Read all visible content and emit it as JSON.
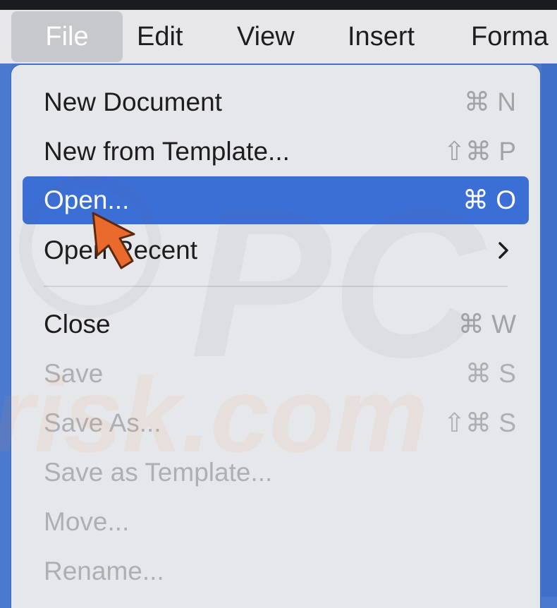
{
  "menubar": {
    "items": [
      {
        "label": "File",
        "selected": true
      },
      {
        "label": "Edit"
      },
      {
        "label": "View"
      },
      {
        "label": "Insert"
      },
      {
        "label": "Forma"
      }
    ]
  },
  "file_menu": {
    "items": [
      {
        "label": "New Document",
        "shortcut": "⌘ N",
        "state": "enabled"
      },
      {
        "label": "New from Template...",
        "shortcut": "⇧⌘ P",
        "state": "enabled"
      },
      {
        "label": "Open...",
        "shortcut": "⌘ O",
        "state": "highlighted"
      },
      {
        "label": "Open Recent",
        "submenu": true,
        "state": "enabled"
      },
      {
        "label": "Close",
        "shortcut": "⌘ W",
        "state": "enabled"
      },
      {
        "label": "Save",
        "shortcut": "⌘ S",
        "state": "disabled"
      },
      {
        "label": "Save As...",
        "shortcut": "⇧⌘ S",
        "state": "disabled"
      },
      {
        "label": "Save as Template...",
        "state": "disabled"
      },
      {
        "label": "Move...",
        "state": "disabled"
      },
      {
        "label": "Rename...",
        "state": "disabled"
      }
    ]
  },
  "watermark": {
    "logo_text": "PC",
    "site_text": "risk.com"
  },
  "colors": {
    "menubar_bg": "#e7e7e9",
    "menu_bg": "#e6e7ea",
    "highlight": "#3b6fd6",
    "desktop": "#4a79cf",
    "cursor": "#e96a2b"
  },
  "icons": {
    "submenu": "chevron-right-icon",
    "pointer": "cursor-arrow-icon"
  }
}
